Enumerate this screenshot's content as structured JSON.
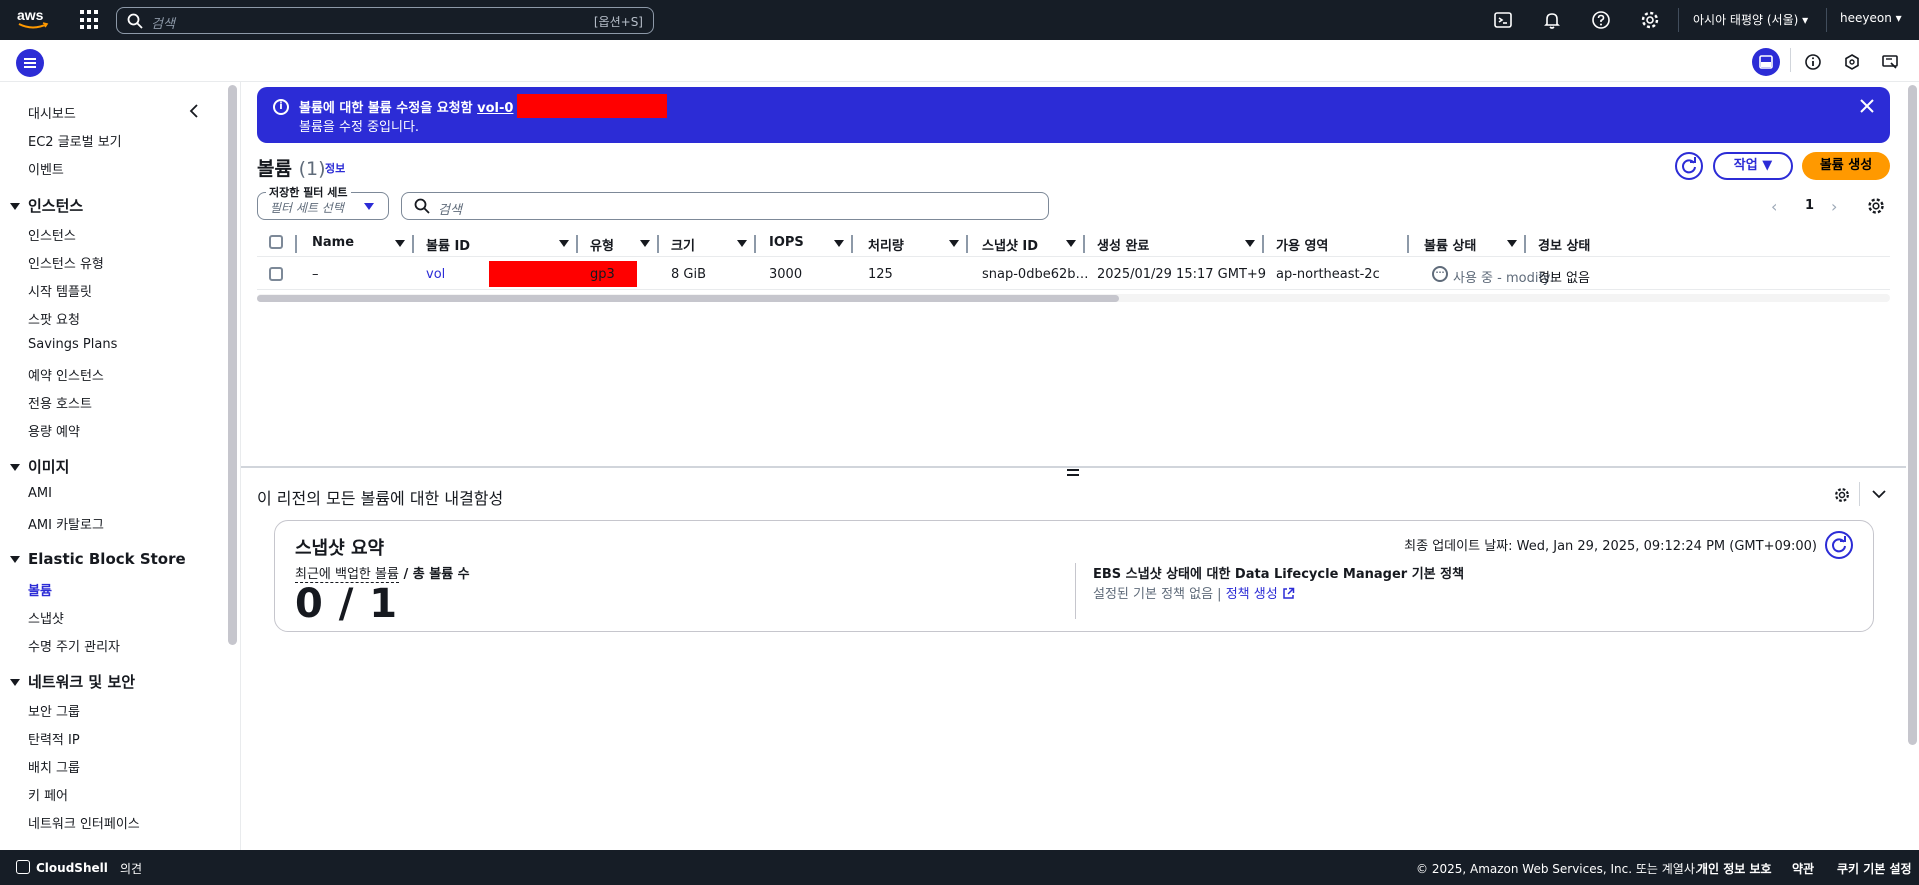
{
  "topbar": {
    "search_placeholder": "검색",
    "search_hint": "[옵션+S]",
    "region": "아시아 태평양 (서울) ▾",
    "user": "heeyeon ▾"
  },
  "sidebar": {
    "items_top": [
      "대시보드",
      "EC2 글로벌 보기",
      "이벤트"
    ],
    "sections": [
      {
        "title": "인스턴스",
        "items": [
          "인스턴스",
          "인스턴스 유형",
          "시작 템플릿",
          "스팟 요청",
          "Savings Plans",
          "예약 인스턴스",
          "전용 호스트",
          "용량 예약"
        ]
      },
      {
        "title": "이미지",
        "items": [
          "AMI",
          "AMI 카탈로그"
        ]
      },
      {
        "title": "Elastic Block Store",
        "items": [
          "볼륨",
          "스냅샷",
          "수명 주기 관리자"
        ]
      },
      {
        "title": "네트워크 및 보안",
        "items": [
          "보안 그룹",
          "탄력적 IP",
          "배치 그룹",
          "키 페어",
          "네트워크 인터페이스"
        ]
      }
    ]
  },
  "flash": {
    "line1_text": "볼륨에 대한 볼륨 수정을 요청함 ",
    "line1_link": "vol-0",
    "line2": "볼륨을 수정 중입니다."
  },
  "volumes": {
    "title": "볼륨",
    "count": "(1)",
    "info": "정보",
    "actions_label": "작업",
    "create_label": "볼륨 생성",
    "filter_set_label": "저장한 필터 세트",
    "filter_set_placeholder": "필터 세트 선택",
    "search_placeholder": "검색",
    "page": "1",
    "columns": [
      "Name",
      "볼륨 ID",
      "유형",
      "크기",
      "IOPS",
      "처리량",
      "스냅샷 ID",
      "생성 완료",
      "가용 영역",
      "볼륨 상태",
      "경보 상태"
    ],
    "rows": [
      {
        "name": "–",
        "volume_id": "vol",
        "type": "gp3",
        "size": "8 GiB",
        "iops": "3000",
        "throughput": "125",
        "snapshot_id": "snap-0dbe62b…",
        "created": "2025/01/29 15:17 GMT+9",
        "az": "ap-northeast-2c",
        "state": "사용 중 - modifying",
        "alarm": "경보 없음"
      }
    ]
  },
  "resilience": {
    "title": "이 리전의 모든 볼륨에 대한 내결함성",
    "card_title": "스냅샷 요약",
    "updated": "최종 업데이트 날짜: Wed, Jan 29, 2025, 09:12:24 PM (GMT+09:00)",
    "metric_label_a": "최근에 백업한 볼륨",
    "metric_label_b": " / 총 볼륨 수",
    "metric_value": "0 / 1",
    "dlm_title": "EBS 스냅샷 상태에 대한 Data Lifecycle Manager 기본 정책",
    "dlm_text": "설정된 기본 정책 없음 | ",
    "dlm_link": "정책 생성"
  },
  "footer": {
    "cloudshell": "CloudShell",
    "feedback": "의견",
    "copyright": "© 2025, Amazon Web Services, Inc. 또는 계열사.",
    "privacy": "개인 정보 보호",
    "terms": "약관",
    "cookies": "쿠키 기본 설정"
  },
  "colors": {
    "accent": "#2c2cd6",
    "topbar": "#161d26",
    "primary_button": "#ff9900",
    "redaction": "#ff0000"
  }
}
